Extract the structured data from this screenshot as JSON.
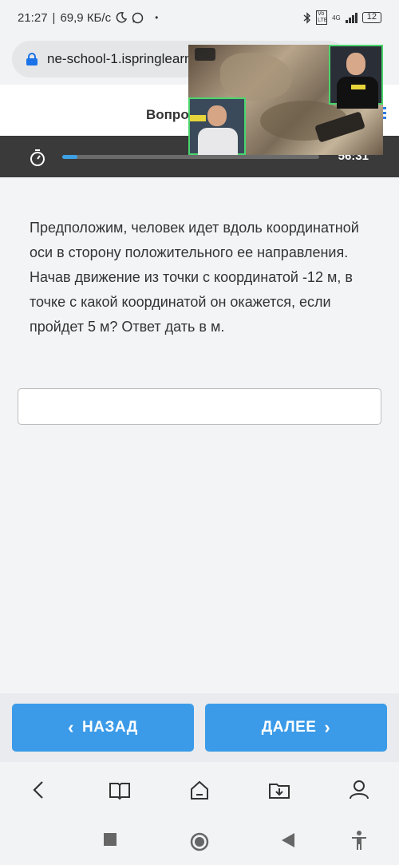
{
  "status_bar": {
    "time": "21:27",
    "separator": "|",
    "network_speed": "69,9 КБ/с",
    "battery": "12",
    "network_type": "4G",
    "volte": "Vo LTE"
  },
  "browser": {
    "url": "ne-school-1.ispringlearn"
  },
  "header": {
    "title": "Вопрос"
  },
  "timer": {
    "time_left": "56:31",
    "progress_fraction": 0.06
  },
  "question": {
    "text": "Предположим, человек идет вдоль координатной оси в сторону положительного ее направления. Начав движение из точки с координатой -12 м, в точке с какой координатой он окажется, если пройдет 5 м? Ответ дать в м.",
    "answer_value": ""
  },
  "footer": {
    "back_label": "НАЗАД",
    "next_label": "ДАЛЕЕ"
  },
  "colors": {
    "accent": "#3b9be8",
    "timer_bg": "#3a3a3a",
    "progress": "#3ea0e4"
  },
  "icons": {
    "toolbar": [
      "back-icon",
      "bookmarks-icon",
      "home-icon",
      "downloads-icon",
      "profile-icon"
    ],
    "system": [
      "recent-apps-icon",
      "home-circle-icon",
      "back-triangle-icon",
      "accessibility-icon"
    ]
  }
}
